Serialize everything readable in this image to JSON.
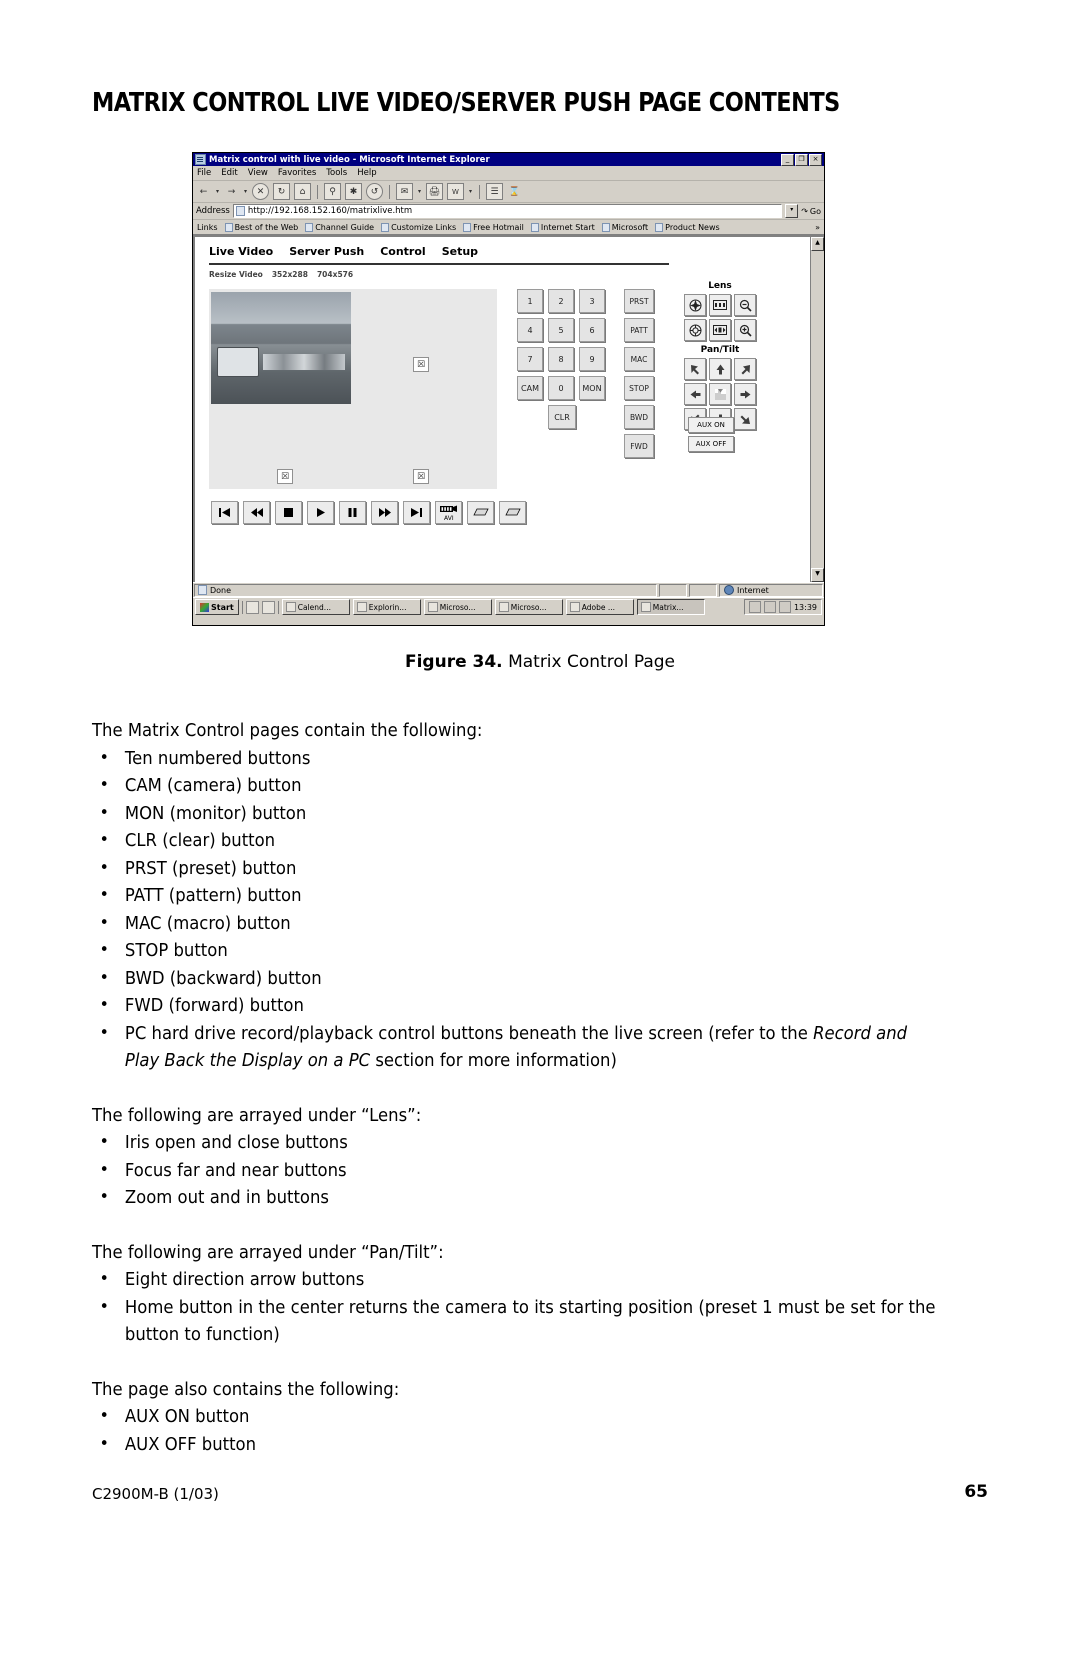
{
  "document": {
    "heading": "MATRIX CONTROL LIVE VIDEO/SERVER PUSH PAGE CONTENTS",
    "figure_caption_label": "Figure 34.",
    "figure_caption_text": "Matrix Control Page",
    "footer_left": "C2900M-B (1/03)",
    "footer_right": "65"
  },
  "browser": {
    "window_title": "Matrix control with live video - Microsoft Internet Explorer",
    "title_icon": "ie-document-icon",
    "window_buttons": [
      {
        "name": "minimize",
        "glyph": "_"
      },
      {
        "name": "maximize",
        "glyph": "❐"
      },
      {
        "name": "close",
        "glyph": "×"
      }
    ],
    "menus": [
      {
        "label": "File",
        "accel": "F"
      },
      {
        "label": "Edit",
        "accel": "E"
      },
      {
        "label": "View",
        "accel": "V"
      },
      {
        "label": "Favorites",
        "accel": "a"
      },
      {
        "label": "Tools",
        "accel": "T"
      },
      {
        "label": "Help",
        "accel": "H"
      }
    ],
    "toolbar_icons": [
      "back-icon",
      "forward-icon",
      "stop-icon",
      "refresh-icon",
      "home-icon",
      "search-icon",
      "favorites-icon",
      "history-icon",
      "mail-icon",
      "print-icon",
      "edit-icon",
      "discuss-icon",
      "messenger-icon"
    ],
    "address_label": "Address",
    "address_value": "http://192.168.152.160/matrixlive.htm",
    "go_label": "Go",
    "links_label": "Links",
    "links": [
      "Best of the Web",
      "Channel Guide",
      "Customize Links",
      "Free Hotmail",
      "Internet Start",
      "Microsoft",
      "Product News"
    ],
    "links_overflow": "»",
    "status_text": "Done",
    "status_zone": "Internet"
  },
  "webpage": {
    "nav": [
      "Live Video",
      "Server Push",
      "Control",
      "Setup"
    ],
    "resize_label": "Resize Video",
    "resize_options": [
      "352x288",
      "704x576"
    ],
    "keypad": [
      "1",
      "2",
      "3",
      "4",
      "5",
      "6",
      "7",
      "8",
      "9",
      "CAM",
      "0",
      "MON"
    ],
    "clr_label": "CLR",
    "command_buttons": [
      "PRST",
      "PATT",
      "MAC",
      "STOP",
      "BWD",
      "FWD"
    ],
    "lens": {
      "title": "Lens",
      "buttons": [
        {
          "name": "iris-open-icon",
          "label": "Iris open"
        },
        {
          "name": "focus-far-icon",
          "label": "Focus far"
        },
        {
          "name": "zoom-out-icon",
          "label": "Zoom out"
        },
        {
          "name": "iris-close-icon",
          "label": "Iris close"
        },
        {
          "name": "focus-near-icon",
          "label": "Focus near"
        },
        {
          "name": "zoom-in-icon",
          "label": "Zoom in"
        }
      ]
    },
    "pantilt": {
      "title": "Pan/Tilt",
      "buttons": [
        {
          "name": "arrow-up-left-icon"
        },
        {
          "name": "arrow-up-icon"
        },
        {
          "name": "arrow-up-right-icon"
        },
        {
          "name": "arrow-left-icon"
        },
        {
          "name": "home-position-icon"
        },
        {
          "name": "arrow-right-icon"
        },
        {
          "name": "arrow-down-left-icon"
        },
        {
          "name": "arrow-down-icon"
        },
        {
          "name": "arrow-down-right-icon"
        }
      ]
    },
    "aux": {
      "on": "AUX ON",
      "off": "AUX OFF"
    },
    "transport": [
      {
        "name": "skip-start-icon",
        "glyph": "⧏▌"
      },
      {
        "name": "rewind-icon",
        "glyph": "◀◀"
      },
      {
        "name": "stop-icon",
        "glyph": "■"
      },
      {
        "name": "play-icon",
        "glyph": "▶"
      },
      {
        "name": "pause-icon",
        "glyph": "❙❙"
      },
      {
        "name": "fast-forward-icon",
        "glyph": "▶▶"
      },
      {
        "name": "skip-end-icon",
        "glyph": "▌▶"
      },
      {
        "name": "record-avi-icon",
        "glyph": "AVI"
      },
      {
        "name": "open-folder-icon",
        "glyph": "▱"
      },
      {
        "name": "open-folder-2-icon",
        "glyph": "▱"
      }
    ],
    "broken_image_glyph": "☒"
  },
  "taskbar": {
    "start_label": "Start",
    "quick_launch": [
      "show-desktop-icon",
      "launch-ie-icon"
    ],
    "items": [
      {
        "label": "Calend...",
        "active": false
      },
      {
        "label": "Explorin...",
        "active": false
      },
      {
        "label": "Microso...",
        "active": false
      },
      {
        "label": "Microso...",
        "active": false
      },
      {
        "label": "Adobe ...",
        "active": false
      },
      {
        "label": "Matrix...",
        "active": true
      }
    ],
    "tray_icons": [
      "network-icon",
      "volume-icon",
      "display-icon"
    ],
    "clock": "13:39"
  },
  "content": {
    "intro": "The Matrix Control pages contain the following:",
    "list1": [
      "Ten numbered buttons",
      "CAM (camera) button",
      "MON (monitor) button",
      "CLR (clear) button",
      "PRST (preset) button",
      "PATT (pattern) button",
      "MAC (macro) button",
      "STOP button",
      "BWD (backward) button",
      "FWD (forward) button"
    ],
    "bullet_pc_part1": "PC hard drive record/playback control buttons beneath the live screen (refer to the ",
    "bullet_pc_italic1": "Record and Play Back the Display on a PC",
    "bullet_pc_part2": " section for more information)",
    "lens_intro": "The following are arrayed under “Lens”:",
    "list2": [
      "Iris open and close buttons",
      "Focus far and near buttons",
      "Zoom out and in buttons"
    ],
    "pantilt_intro": "The following are arrayed under “Pan/Tilt”:",
    "list3_item1": "Eight direction arrow buttons",
    "list3_item2": "Home button in the center returns the camera to its starting position (preset 1 must be set for the button to function)",
    "also_intro": "The page also contains the following:",
    "list4": [
      "AUX ON button",
      "AUX OFF button"
    ]
  }
}
